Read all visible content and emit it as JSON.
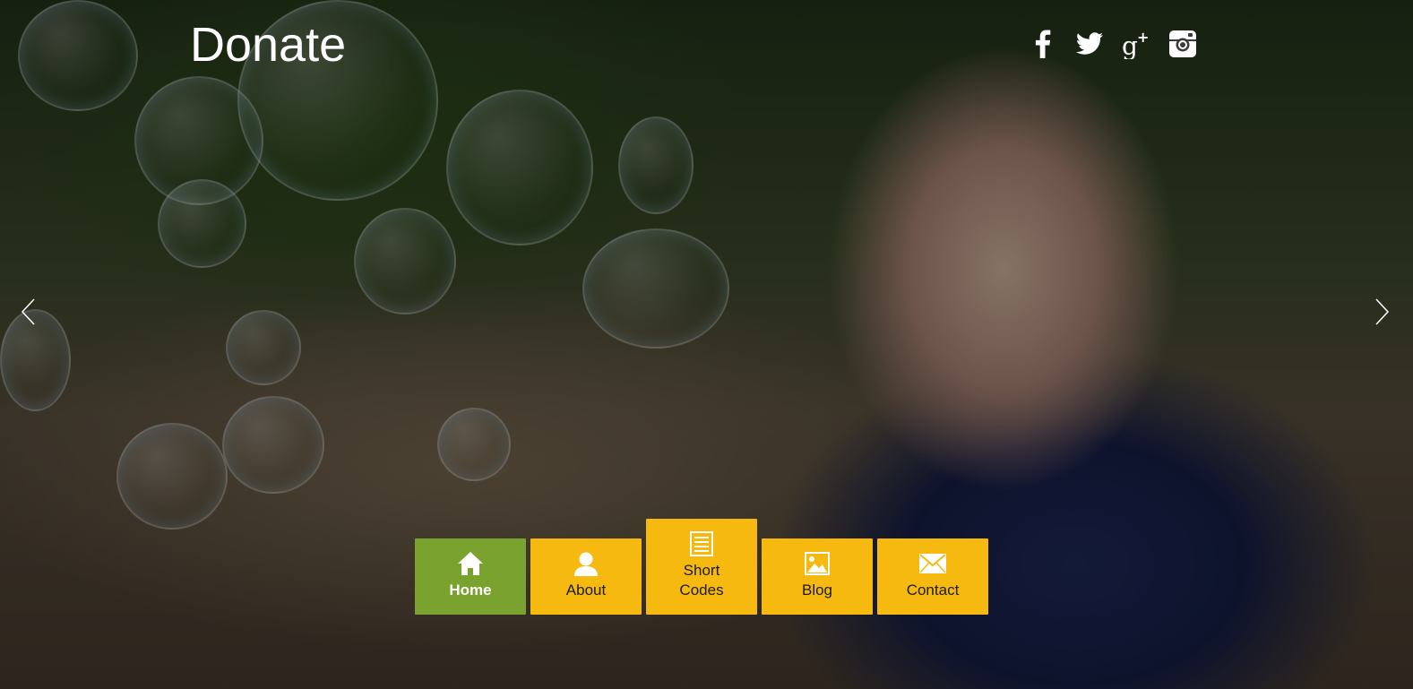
{
  "site": {
    "logo_text": "Donate"
  },
  "social": [
    {
      "name": "facebook",
      "icon": "facebook-icon"
    },
    {
      "name": "twitter",
      "icon": "twitter-icon"
    },
    {
      "name": "google-plus",
      "icon": "google-plus-icon"
    },
    {
      "name": "instagram",
      "icon": "instagram-icon"
    }
  ],
  "slider": {
    "prev_icon": "chevron-left-icon",
    "next_icon": "chevron-right-icon"
  },
  "nav": {
    "items": [
      {
        "label": "Home",
        "icon": "home-icon",
        "active": true
      },
      {
        "label": "About",
        "icon": "user-icon",
        "active": false
      },
      {
        "label": "Short\nCodes",
        "icon": "document-list-icon",
        "active": false
      },
      {
        "label": "Blog",
        "icon": "image-icon",
        "active": false
      },
      {
        "label": "Contact",
        "icon": "envelope-icon",
        "active": false
      }
    ]
  },
  "colors": {
    "nav_default": "#f5b910",
    "nav_active": "#7aa22e",
    "text_light": "#ffffff"
  }
}
